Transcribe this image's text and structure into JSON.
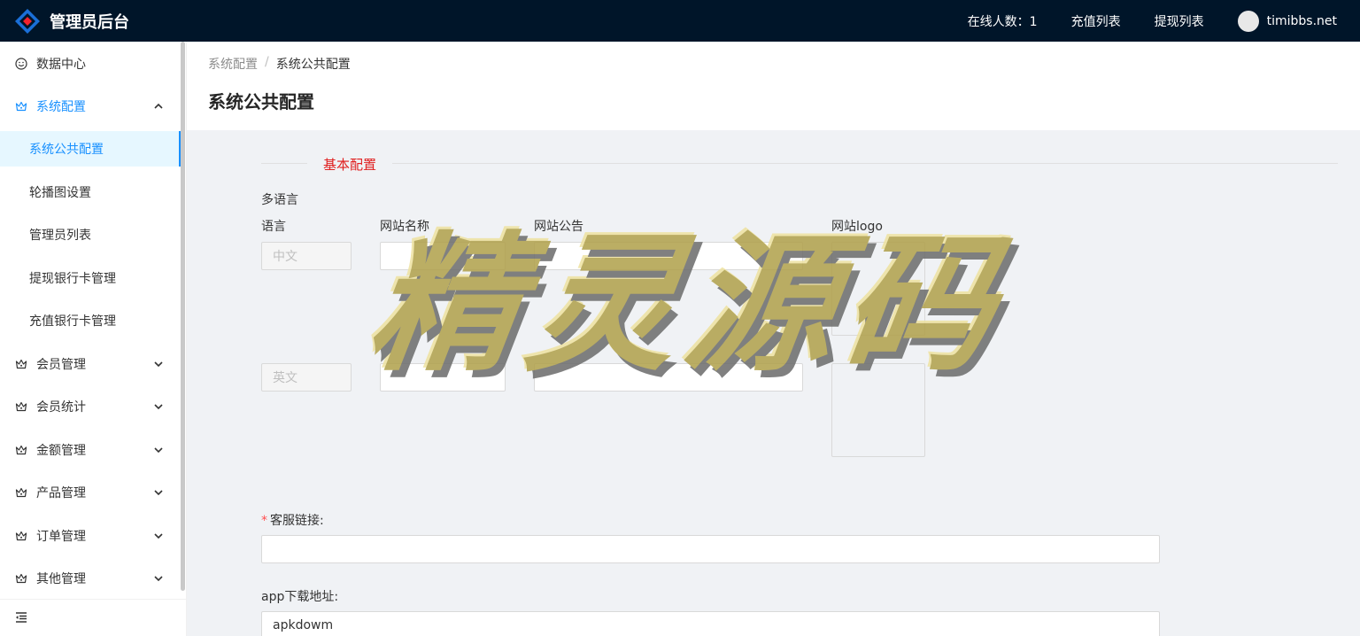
{
  "header": {
    "title": "管理员后台",
    "online_label": "在线人数：1",
    "recharge_list": "充值列表",
    "withdraw_list": "提现列表",
    "username": "timibbs.net"
  },
  "sidebar": {
    "items": [
      {
        "label": "数据中心",
        "icon": "smile-icon"
      },
      {
        "label": "系统配置",
        "icon": "crown-icon",
        "open": true
      },
      {
        "label": "会员管理",
        "icon": "crown-icon"
      },
      {
        "label": "会员统计",
        "icon": "crown-icon"
      },
      {
        "label": "金额管理",
        "icon": "crown-icon"
      },
      {
        "label": "产品管理",
        "icon": "crown-icon"
      },
      {
        "label": "订单管理",
        "icon": "crown-icon"
      },
      {
        "label": "其他管理",
        "icon": "crown-icon"
      }
    ],
    "sub_items": [
      {
        "label": "系统公共配置",
        "active": true
      },
      {
        "label": "轮播图设置"
      },
      {
        "label": "管理员列表"
      },
      {
        "label": "提现银行卡管理"
      },
      {
        "label": "充值银行卡管理"
      }
    ]
  },
  "breadcrumb": {
    "parent": "系统配置",
    "separator": "/",
    "current": "系统公共配置"
  },
  "page_title": "系统公共配置",
  "form": {
    "section_title": "基本配置",
    "multilang_label": "多语言",
    "col_language": "语言",
    "col_site_name": "网站名称",
    "col_notice": "网站公告",
    "col_logo": "网站logo",
    "lang_zh": "中文",
    "lang_en": "英文",
    "service_link_label": "客服链接:",
    "service_link_value": "",
    "app_download_label": "app下载地址:",
    "app_download_value": "apkdowm"
  },
  "watermark": "精灵源码",
  "colors": {
    "header_bg": "#001529",
    "accent": "#1890ff",
    "required": "#ff4d4f",
    "section_title": "#e02020"
  }
}
